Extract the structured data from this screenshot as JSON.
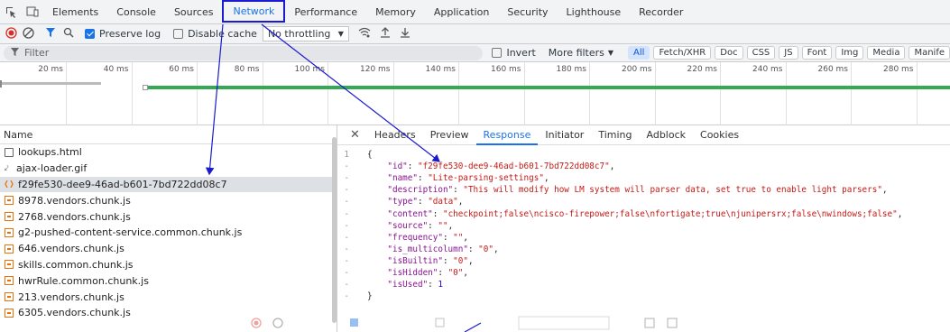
{
  "tabs": [
    "Elements",
    "Console",
    "Sources",
    "Network",
    "Performance",
    "Memory",
    "Application",
    "Security",
    "Lighthouse",
    "Recorder"
  ],
  "active_tab": "Network",
  "toolbar": {
    "preserve_log": "Preserve log",
    "disable_cache": "Disable cache",
    "throttling": "No throttling"
  },
  "filter": {
    "placeholder": "Filter",
    "invert": "Invert",
    "more_filters": "More filters",
    "chips": [
      "All",
      "Fetch/XHR",
      "Doc",
      "CSS",
      "JS",
      "Font",
      "Img",
      "Media",
      "Manife"
    ]
  },
  "timeline": {
    "ticks": [
      "20 ms",
      "40 ms",
      "60 ms",
      "80 ms",
      "100 ms",
      "120 ms",
      "140 ms",
      "160 ms",
      "180 ms",
      "200 ms",
      "220 ms",
      "240 ms",
      "260 ms",
      "280 ms"
    ]
  },
  "requests": {
    "header": "Name",
    "items": [
      {
        "name": "lookups.html",
        "type": "doc"
      },
      {
        "name": "ajax-loader.gif",
        "type": "img"
      },
      {
        "name": "f29fe530-dee9-46ad-b601-7bd722dd08c7",
        "type": "fetch",
        "selected": true
      },
      {
        "name": "8978.vendors.chunk.js",
        "type": "js"
      },
      {
        "name": "2768.vendors.chunk.js",
        "type": "js"
      },
      {
        "name": "g2-pushed-content-service.common.chunk.js",
        "type": "js"
      },
      {
        "name": "646.vendors.chunk.js",
        "type": "js"
      },
      {
        "name": "skills.common.chunk.js",
        "type": "js"
      },
      {
        "name": "hwrRule.common.chunk.js",
        "type": "js"
      },
      {
        "name": "213.vendors.chunk.js",
        "type": "js"
      },
      {
        "name": "6305.vendors.chunk.js",
        "type": "js"
      }
    ]
  },
  "detail_tabs": [
    "Headers",
    "Preview",
    "Response",
    "Initiator",
    "Timing",
    "Adblock",
    "Cookies"
  ],
  "active_detail_tab": "Response",
  "response": {
    "first_line_number": "1",
    "lines": [
      {
        "k": "",
        "v": "{",
        "t": "pun",
        "gutter": "1"
      },
      {
        "k": "\"id\"",
        "v": "\"f29fe530-dee9-46ad-b601-7bd722dd08c7\"",
        "t": "str",
        "gutter": "-"
      },
      {
        "k": "\"name\"",
        "v": "\"Lite-parsing-settings\"",
        "t": "str",
        "gutter": "-"
      },
      {
        "k": "\"description\"",
        "v": "\"This will modify how LM system will parser data, set true to enable light parsers\"",
        "t": "str",
        "gutter": "-"
      },
      {
        "k": "\"type\"",
        "v": "\"data\"",
        "t": "str",
        "gutter": "-"
      },
      {
        "k": "\"content\"",
        "v": "\"checkpoint;false\\ncisco-firepower;false\\nfortigate;true\\njunipersrx;false\\nwindows;false\"",
        "t": "str",
        "gutter": "-"
      },
      {
        "k": "\"source\"",
        "v": "\"\"",
        "t": "str",
        "gutter": "-"
      },
      {
        "k": "\"frequency\"",
        "v": "\"\"",
        "t": "str",
        "gutter": "-"
      },
      {
        "k": "\"is_multicolumn\"",
        "v": "\"0\"",
        "t": "str",
        "gutter": "-"
      },
      {
        "k": "\"isBuiltin\"",
        "v": "\"0\"",
        "t": "str",
        "gutter": "-"
      },
      {
        "k": "\"isHidden\"",
        "v": "\"0\"",
        "t": "str",
        "gutter": "-"
      },
      {
        "k": "\"isUsed\"",
        "v": "1",
        "t": "num",
        "gutter": "-",
        "last": true
      },
      {
        "k": "",
        "v": "}",
        "t": "pun",
        "gutter": "-"
      }
    ]
  },
  "colors": {
    "accent": "#1a73e8",
    "annotation": "#1a1ad0",
    "progress": "#34a853"
  }
}
